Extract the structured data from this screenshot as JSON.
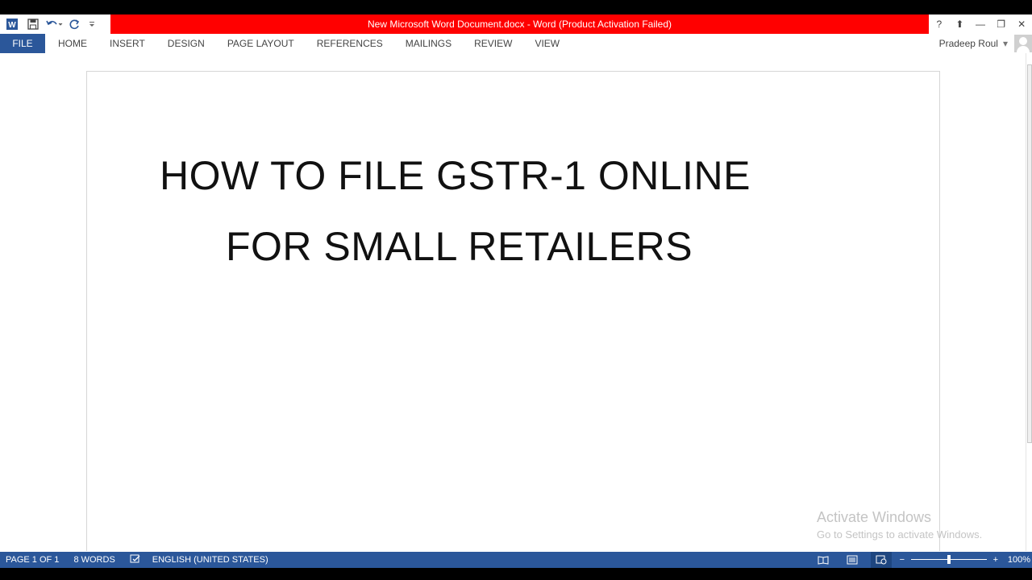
{
  "window": {
    "title": "New Microsoft Word Document.docx -  Word (Product Activation Failed)",
    "accent_color": "#2b579a",
    "title_bar_color": "#ff0000"
  },
  "quick_access": {
    "icons": [
      "word-app-icon",
      "save-icon",
      "undo-icon",
      "redo-icon",
      "customize-icon"
    ]
  },
  "window_controls": {
    "help": "?",
    "ribbon_display": "⬆",
    "minimize": "—",
    "restore": "❐",
    "close": "✕"
  },
  "ribbon": {
    "tabs": [
      "FILE",
      "HOME",
      "INSERT",
      "DESIGN",
      "PAGE LAYOUT",
      "REFERENCES",
      "MAILINGS",
      "REVIEW",
      "VIEW"
    ]
  },
  "user": {
    "name": "Pradeep Roul",
    "dropdown": "▾"
  },
  "document": {
    "lines": [
      "HOW TO FILE GSTR-1 ONLINE",
      "FOR SMALL RETAILERS"
    ]
  },
  "watermark": {
    "line1": "Activate Windows",
    "line2": "Go to Settings to activate Windows."
  },
  "status_bar": {
    "page": "PAGE 1 OF 1",
    "words": "8 WORDS",
    "language": "ENGLISH (UNITED STATES)",
    "zoom_minus": "−",
    "zoom_plus": "+",
    "zoom": "100%",
    "zoom_level": 100
  }
}
